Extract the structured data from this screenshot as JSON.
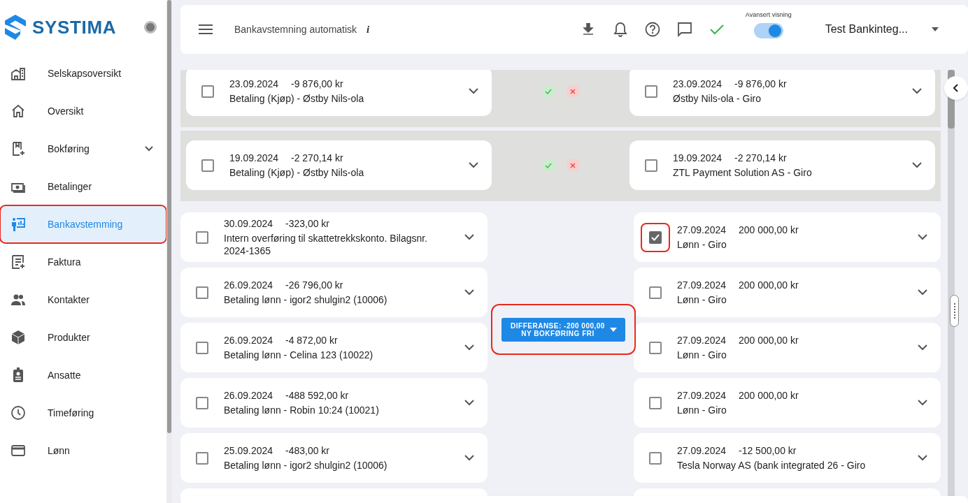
{
  "sidebar": {
    "logo": "SYSTIMA",
    "items": [
      {
        "label": "Selskapsoversikt",
        "selected": false,
        "expandable": false,
        "highlighted": false
      },
      {
        "label": "Oversikt",
        "selected": false,
        "expandable": false,
        "highlighted": false
      },
      {
        "label": "Bokføring",
        "selected": false,
        "expandable": true,
        "highlighted": false
      },
      {
        "label": "Betalinger",
        "selected": false,
        "expandable": false,
        "highlighted": false
      },
      {
        "label": "Bankavstemming",
        "selected": true,
        "expandable": false,
        "highlighted": true
      },
      {
        "label": "Faktura",
        "selected": false,
        "expandable": false,
        "highlighted": false
      },
      {
        "label": "Kontakter",
        "selected": false,
        "expandable": false,
        "highlighted": false
      },
      {
        "label": "Produkter",
        "selected": false,
        "expandable": false,
        "highlighted": false
      },
      {
        "label": "Ansatte",
        "selected": false,
        "expandable": false,
        "highlighted": false
      },
      {
        "label": "Timeføring",
        "selected": false,
        "expandable": false,
        "highlighted": false
      },
      {
        "label": "Lønn",
        "selected": false,
        "expandable": false,
        "highlighted": false
      }
    ]
  },
  "header": {
    "title": "Bankavstemning automatisk",
    "info_glyph": "i",
    "toggle": {
      "label": "Avansert visning",
      "on": true
    },
    "company": "Test Bankinteg..."
  },
  "matched_pairs": [
    {
      "left": {
        "date": "23.09.2024",
        "amount": "-9 876,00 kr",
        "text": "Betaling (Kjøp) - Østby Nils-ola",
        "checked": false
      },
      "right": {
        "date": "23.09.2024",
        "amount": "-9 876,00 kr",
        "text": "Østby Nils-ola - Giro",
        "checked": false
      }
    },
    {
      "left": {
        "date": "19.09.2024",
        "amount": "-2 270,14 kr",
        "text": "Betaling (Kjøp) - Østby Nils-ola",
        "checked": false
      },
      "right": {
        "date": "19.09.2024",
        "amount": "-2 270,14 kr",
        "text": "ZTL Payment Solution AS - Giro",
        "checked": false
      }
    }
  ],
  "unmatched_rows": [
    {
      "left": {
        "date": "30.09.2024",
        "amount": "-323,00 kr",
        "text": "Intern overføring til skattetrekkskonto. Bilagsnr. 2024-1365",
        "checked": false,
        "highlighted": false
      },
      "right": {
        "date": "27.09.2024",
        "amount": "200 000,00 kr",
        "text": "Lønn - Giro",
        "checked": true,
        "highlighted": true
      }
    },
    {
      "left": {
        "date": "26.09.2024",
        "amount": "-26 796,00 kr",
        "text": "Betaling lønn - igor2 shulgin2 (10006)",
        "checked": false,
        "highlighted": false
      },
      "right": {
        "date": "27.09.2024",
        "amount": "200 000,00 kr",
        "text": "Lønn - Giro",
        "checked": false,
        "highlighted": false
      }
    },
    {
      "left": {
        "date": "26.09.2024",
        "amount": "-4 872,00 kr",
        "text": "Betaling lønn - Celina 123 (10022)",
        "checked": false,
        "highlighted": false
      },
      "right": {
        "date": "27.09.2024",
        "amount": "200 000,00 kr",
        "text": "Lønn - Giro",
        "checked": false,
        "highlighted": false
      }
    },
    {
      "left": {
        "date": "26.09.2024",
        "amount": "-488 592,00 kr",
        "text": "Betaling lønn - Robin 10:24 (10021)",
        "checked": false,
        "highlighted": false
      },
      "right": {
        "date": "27.09.2024",
        "amount": "200 000,00 kr",
        "text": "Lønn - Giro",
        "checked": false,
        "highlighted": false
      }
    },
    {
      "left": {
        "date": "25.09.2024",
        "amount": "-483,00 kr",
        "text": "Betaling lønn - igor2 shulgin2 (10006)",
        "checked": false,
        "highlighted": false
      },
      "right": {
        "date": "27.09.2024",
        "amount": "-12 500,00 kr",
        "text": "Tesla Norway AS (bank integrated 26 - Giro",
        "checked": false,
        "highlighted": false
      }
    }
  ],
  "difference_button": {
    "lines": [
      "DIFFERANSE: -200 000,00",
      "NY BOKFØRING FRI"
    ],
    "highlighted": true
  }
}
